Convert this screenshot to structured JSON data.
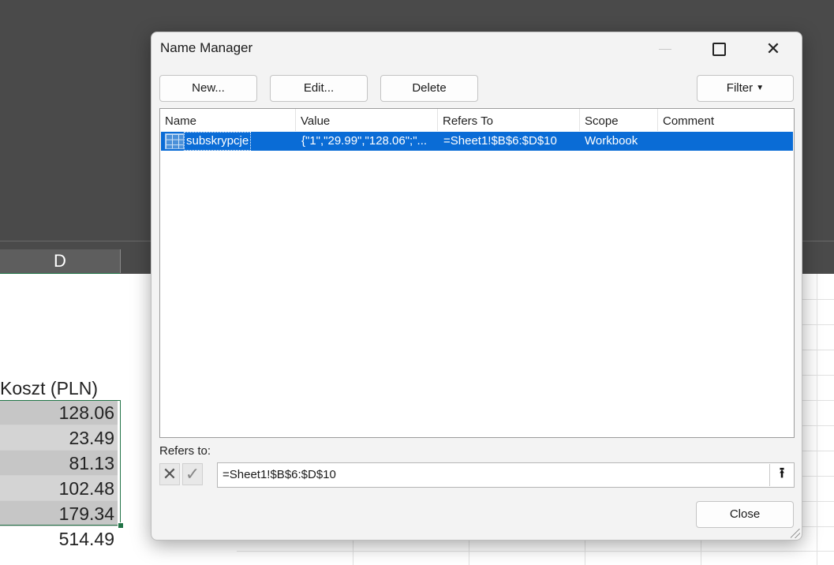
{
  "sheet": {
    "column_label": "D",
    "header_cell": "Koszt (PLN)",
    "values": [
      "128.06",
      "23.49",
      "81.13",
      "102.48",
      "179.34"
    ],
    "total": "514.49"
  },
  "dialog": {
    "title": "Name Manager",
    "buttons": {
      "new": "New...",
      "edit": "Edit...",
      "delete": "Delete",
      "filter": "Filter",
      "close": "Close"
    },
    "columns": {
      "name": "Name",
      "value": "Value",
      "refers_to": "Refers To",
      "scope": "Scope",
      "comment": "Comment"
    },
    "rows": [
      {
        "name": "subskrypcje",
        "value": "{\"1\",\"29.99\",\"128.06\";\"...",
        "refers_to": "=Sheet1!$B$6:$D$10",
        "scope": "Workbook",
        "comment": ""
      }
    ],
    "refers_to_label": "Refers to:",
    "refers_to_value": "=Sheet1!$B$6:$D$10"
  },
  "colors": {
    "selection": "#0a6cd6",
    "excel_green": "#217346"
  }
}
